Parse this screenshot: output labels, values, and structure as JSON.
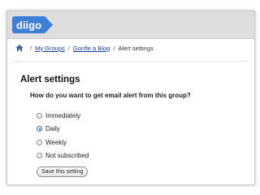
{
  "app": {
    "logo_text": "diigo",
    "colors": {
      "logo_bg": "#3d7fd6",
      "link": "#1a3d9e"
    }
  },
  "breadcrumb": {
    "home_icon": "home-icon",
    "separator": "/",
    "items": [
      {
        "label": "My Groups",
        "link": true
      },
      {
        "label": "Gonfle a Blog",
        "link": true
      },
      {
        "label": "Alert settings",
        "link": false
      }
    ]
  },
  "main": {
    "title": "Alert settings",
    "question": "How do you want to get email alert from this group?",
    "options": [
      {
        "label": "Immediately",
        "checked": false
      },
      {
        "label": "Daily",
        "checked": true
      },
      {
        "label": "Weekly",
        "checked": false
      },
      {
        "label": "Not subscribed",
        "checked": false
      }
    ],
    "save_label": "Save this setting"
  }
}
